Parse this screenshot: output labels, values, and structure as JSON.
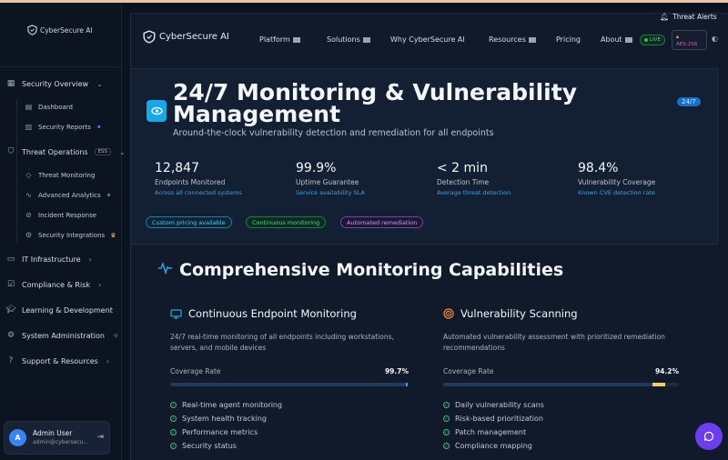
{
  "brand": {
    "name": "CyberSecure AI"
  },
  "header": {
    "alerts_label": "Threat Alerts",
    "nav": [
      "Platform",
      "Solutions",
      "Why CyberSecure AI",
      "Resources",
      "Pricing",
      "About"
    ],
    "live_label": "LIVE",
    "aes_label": "AES-256"
  },
  "sidebar": {
    "sections": [
      {
        "label": "Security Overview"
      },
      {
        "label": "Threat Operations",
        "tag": "ESS"
      },
      {
        "label": "IT Infrastructure"
      },
      {
        "label": "Compliance & Risk"
      },
      {
        "label": "Learning & Development"
      },
      {
        "label": "System Administration"
      },
      {
        "label": "Support & Resources"
      }
    ],
    "sub_overview": [
      "Dashboard",
      "Security Reports"
    ],
    "sub_threat": [
      "Threat Monitoring",
      "Advanced Analytics",
      "Incident Response",
      "Security Integrations"
    ]
  },
  "user": {
    "initial": "A",
    "name": "Admin User",
    "email": "admin@cybersecu..."
  },
  "hero": {
    "title": "24/7 Monitoring & Vulnerability Management",
    "badge": "24/7",
    "subtitle": "Around-the-clock vulnerability detection and remediation for all endpoints",
    "stats": [
      {
        "value": "12,847",
        "label": "Endpoints Monitored",
        "sub": "Across all connected systems"
      },
      {
        "value": "99.9%",
        "label": "Uptime Guarantee",
        "sub": "Service availability SLA"
      },
      {
        "value": "< 2 min",
        "label": "Detection Time",
        "sub": "Average threat detection"
      },
      {
        "value": "98.4%",
        "label": "Vulnerability Coverage",
        "sub": "Known CVE detection rate"
      }
    ],
    "chips": [
      "Custom pricing available",
      "Continuous monitoring",
      "Automated remediation"
    ]
  },
  "capabilities": {
    "title": "Comprehensive Monitoring Capabilities",
    "cards": [
      {
        "title": "Continuous Endpoint Monitoring",
        "description": "24/7 real-time monitoring of all endpoints including workstations, servers, and mobile devices",
        "coverage_label": "Coverage Rate",
        "coverage_value": "99.7%",
        "coverage_fraction": 0.997,
        "features": [
          "Real-time agent monitoring",
          "System health tracking",
          "Performance metrics",
          "Security status"
        ]
      },
      {
        "title": "Vulnerability Scanning",
        "description": "Automated vulnerability assessment with prioritized remediation recommendations",
        "coverage_label": "Coverage Rate",
        "coverage_value": "94.2%",
        "coverage_fraction": 0.942,
        "features": [
          "Daily vulnerability scans",
          "Risk-based prioritization",
          "Patch management",
          "Compliance mapping"
        ]
      }
    ]
  },
  "colors": {
    "accent": "#1aa7e8",
    "success": "#3fbf7a",
    "chat": "#6d3ef0"
  }
}
